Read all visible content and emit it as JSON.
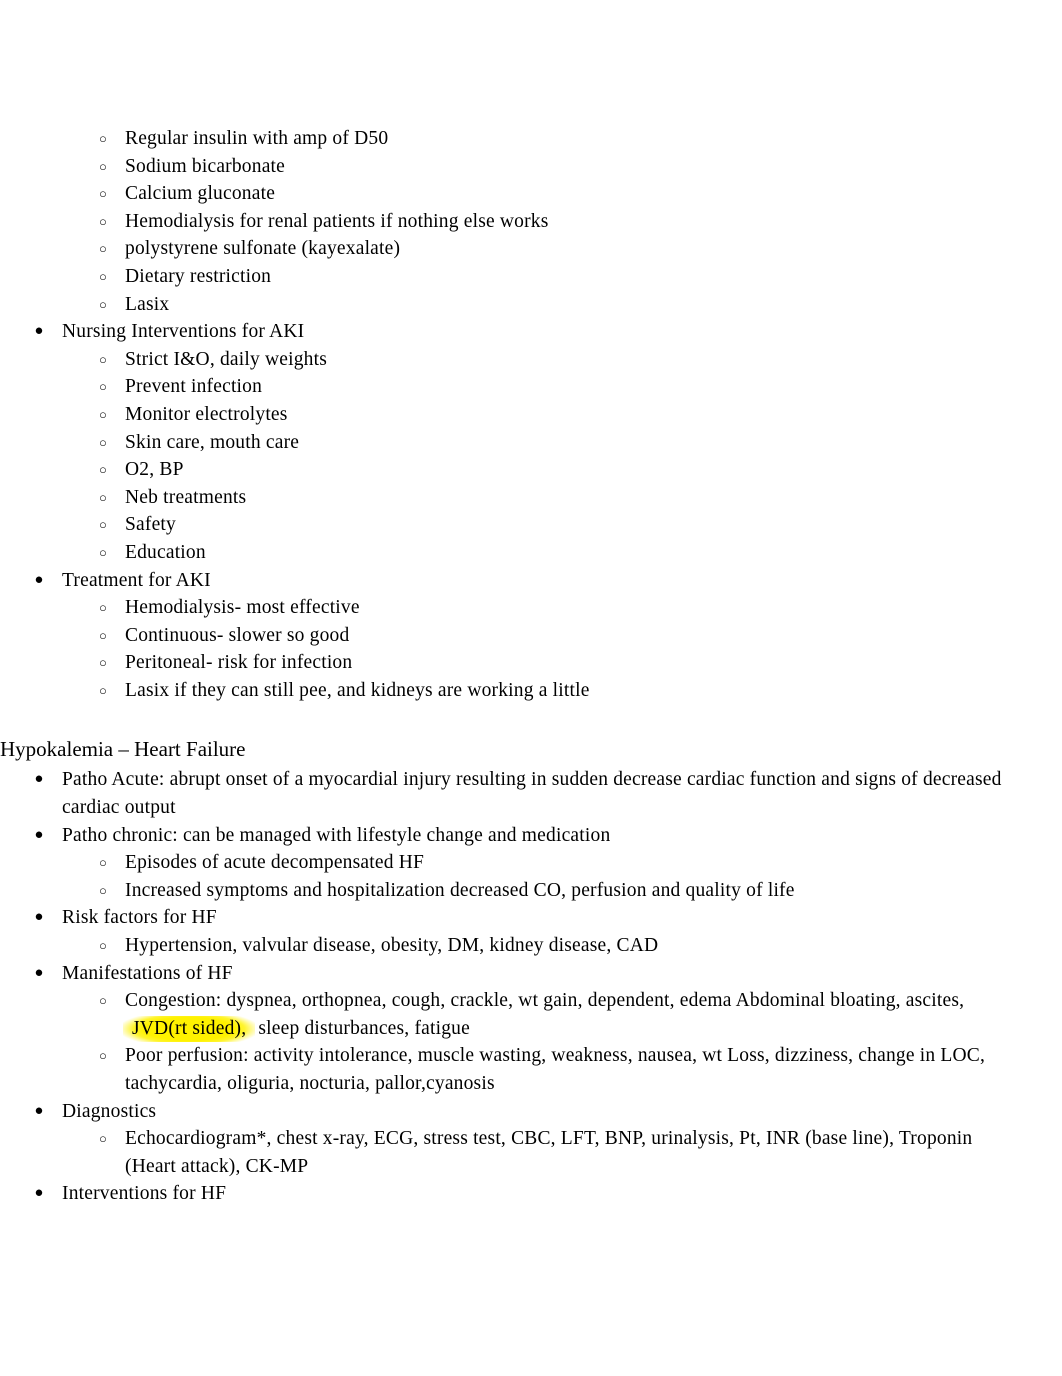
{
  "document": {
    "page_background": "#ffffff",
    "text_color": "#000000",
    "highlight_color": "#fff200",
    "bullet_level1_glyph": "●",
    "bullet_level2_glyph": "○"
  },
  "blocks": [
    {
      "type": "list",
      "level": 2,
      "items": [
        "Regular insulin with amp of D50",
        "Sodium bicarbonate",
        "Calcium gluconate",
        "Hemodialysis for renal patients if nothing else works",
        "polystyrene sulfonate (kayexalate)",
        "Dietary restriction",
        "Lasix"
      ]
    },
    {
      "type": "list",
      "level": 1,
      "items": [
        "Nursing Interventions for AKI"
      ]
    },
    {
      "type": "list",
      "level": 2,
      "items": [
        "Strict I&O, daily weights",
        "Prevent infection",
        "Monitor electrolytes",
        "Skin care, mouth care",
        "O2, BP",
        "Neb treatments",
        "Safety",
        "Education"
      ]
    },
    {
      "type": "list",
      "level": 1,
      "items": [
        "Treatment for AKI"
      ]
    },
    {
      "type": "list",
      "level": 2,
      "items": [
        "Hemodialysis- most effective",
        "Continuous- slower so good",
        "Peritoneal- risk for infection",
        "Lasix if they can still pee, and kidneys are working a little"
      ]
    }
  ],
  "heart_failure_section": {
    "heading": "Hypokalemia – Heart Failure",
    "patho_acute": "Patho Acute: abrupt onset of a myocardial injury resulting in sudden decrease cardiac function and signs of decreased cardiac output",
    "patho_chronic": "Patho chronic: can be managed with lifestyle change and medication",
    "patho_chronic_sub": [
      "Episodes of acute decompensated HF",
      "Increased symptoms and hospitalization decreased CO, perfusion and quality of life"
    ],
    "risk_factors_label": "Risk factors for HF",
    "risk_factors_sub": [
      "Hypertension, valvular disease, obesity, DM, kidney disease, CAD"
    ],
    "manifestations_label": "Manifestations of HF",
    "congestion": {
      "before_highlight": "Congestion: dyspnea, orthopnea, cough, crackle, wt gain, dependent, edema Abdominal bloating, ascites,",
      "highlighted": "JVD(rt sided),",
      "after_highlight": "sleep disturbances, fatigue"
    },
    "poor_perfusion": "Poor perfusion: activity intolerance, muscle wasting, weakness, nausea, wt Loss, dizziness, change in LOC, tachycardia, oliguria, nocturia, pallor,cyanosis",
    "diagnostics_label": "Diagnostics",
    "diagnostics_sub": [
      "Echocardiogram*, chest x-ray, ECG, stress test, CBC, LFT, BNP, urinalysis, Pt, INR (base line), Troponin (Heart attack), CK-MP"
    ],
    "interventions_label": "Interventions for HF"
  }
}
